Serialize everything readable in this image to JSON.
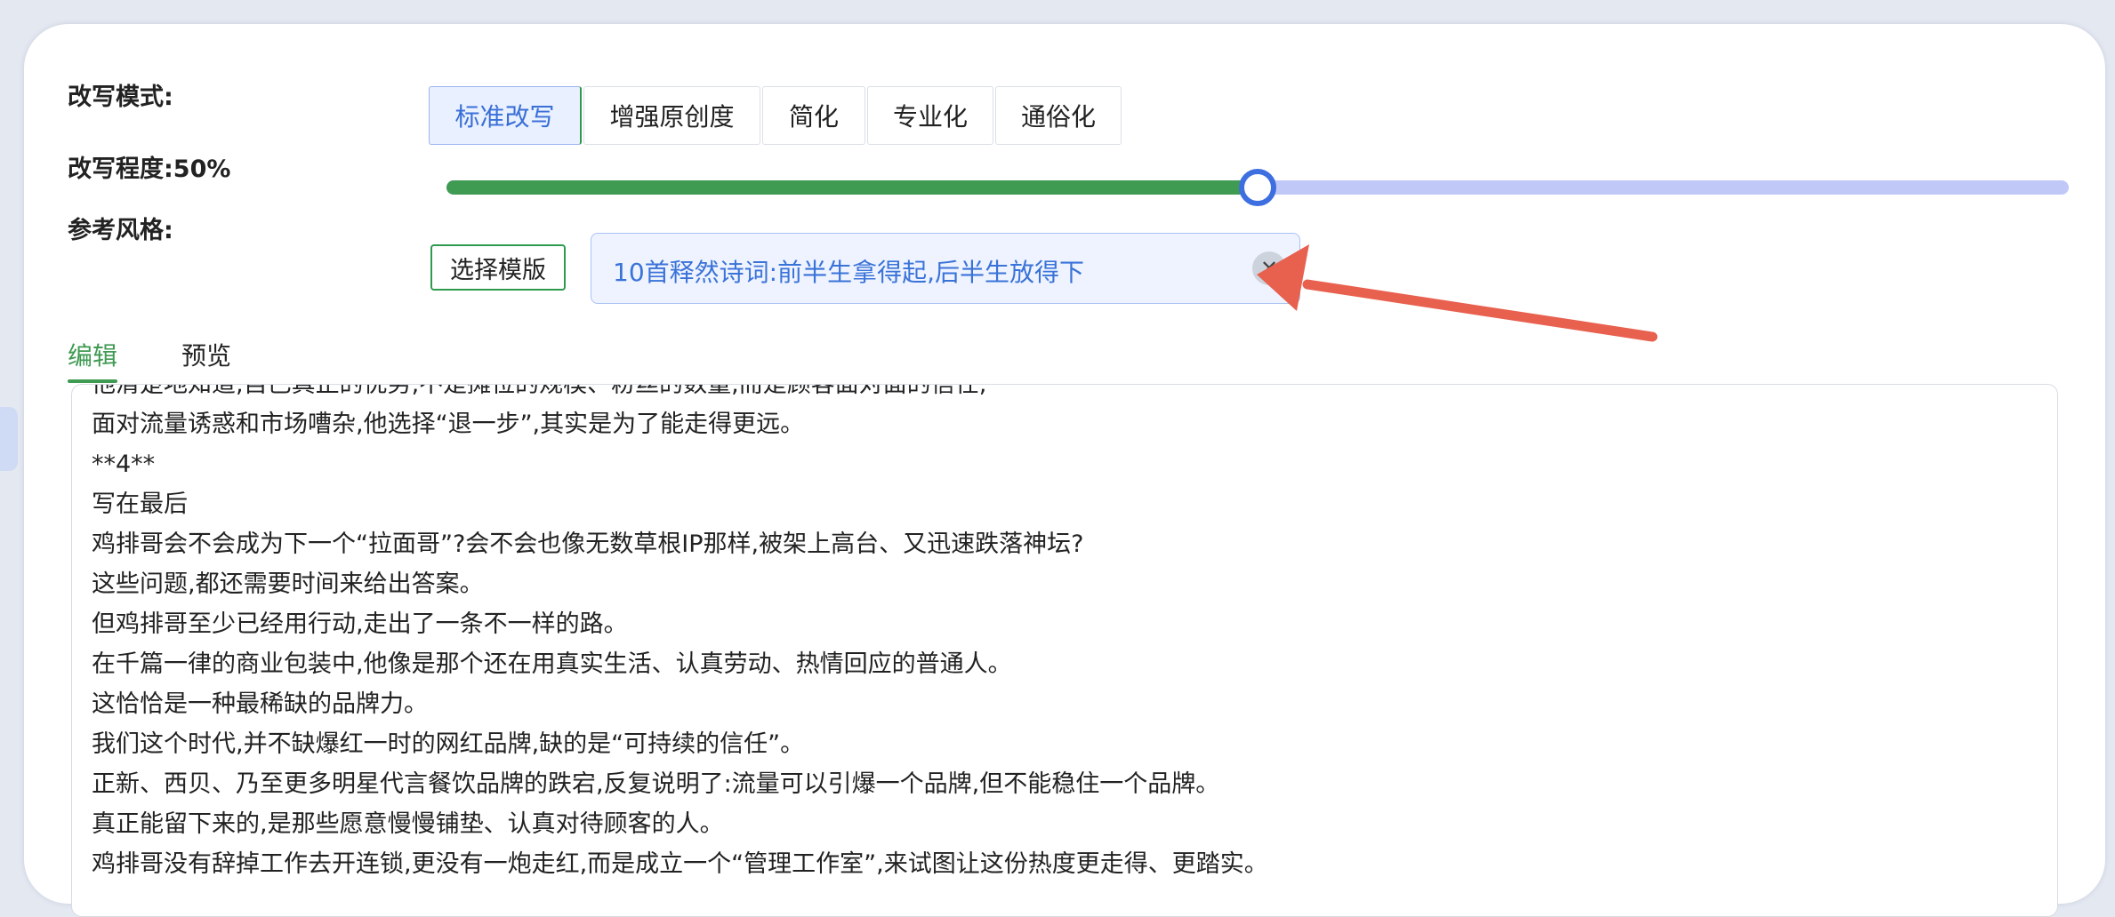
{
  "settings": {
    "mode_label": "改写模式:",
    "modes": [
      "标准改写",
      "增强原创度",
      "简化",
      "专业化",
      "通俗化"
    ],
    "active_mode": "标准改写",
    "degree_label": "改写程度:50%",
    "degree_value": 0.5,
    "style_label": "参考风格:",
    "select_template_label": "选择模版",
    "selected_template": "10首释然诗词:前半生拿得起,后半生放得下",
    "clear_icon": "close-icon",
    "colors": {
      "accent_green": "#3f9a52",
      "accent_blue": "#3d6fe0",
      "annotation_arrow": "#e8604e"
    }
  },
  "tabs": {
    "edit_label": "编辑",
    "preview_label": "预览",
    "active": "编辑"
  },
  "editor": {
    "lines": [
      "他清楚地知道,自己真正的优势,不是摊位的规模、粉丝的数量,而是顾客面对面的信任,",
      "面对流量诱惑和市场嘈杂,他选择“退一步”,其实是为了能走得更远。",
      "**4**",
      "写在最后",
      "鸡排哥会不会成为下一个“拉面哥”?会不会也像无数草根IP那样,被架上高台、又迅速跌落神坛?",
      "这些问题,都还需要时间来给出答案。",
      "但鸡排哥至少已经用行动,走出了一条不一样的路。",
      "在千篇一律的商业包装中,他像是那个还在用真实生活、认真劳动、热情回应的普通人。",
      "这恰恰是一种最稀缺的品牌力。",
      "我们这个时代,并不缺爆红一时的网红品牌,缺的是“可持续的信任”。",
      "正新、西贝、乃至更多明星代言餐饮品牌的跌宕,反复说明了:流量可以引爆一个品牌,但不能稳住一个品牌。",
      "真正能留下来的,是那些愿意慢慢铺垫、认真对待顾客的人。",
      "鸡排哥没有辞掉工作去开连锁,更没有一炮走红,而是成立一个“管理工作室”,来试图让这份热度更走得、更踏实。"
    ]
  }
}
